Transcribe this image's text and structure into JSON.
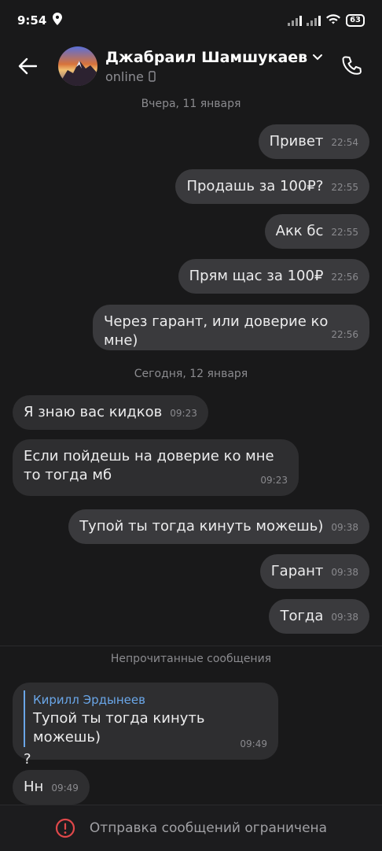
{
  "status_bar": {
    "time": "9:54",
    "battery": "63"
  },
  "header": {
    "name": "Джабраил Шамшукаев",
    "status": "online"
  },
  "dates": {
    "yesterday": "Вчера, 11 января",
    "today": "Сегодня, 12 января"
  },
  "messages": [
    {
      "text": "Привет",
      "time": "22:54",
      "dir": "out"
    },
    {
      "text": "Продашь за 100₽?",
      "time": "22:55",
      "dir": "out"
    },
    {
      "text": "Акк бс",
      "time": "22:55",
      "dir": "out"
    },
    {
      "text": "Прям щас за 100₽",
      "time": "22:56",
      "dir": "out"
    },
    {
      "text": "Через гарант, или доверие ко мне)",
      "time": "22:56",
      "dir": "out"
    },
    {
      "text": "Я знаю вас кидков",
      "time": "09:23",
      "dir": "in"
    },
    {
      "text": "Если пойдешь на доверие ко мне то тогда мб",
      "time": "09:23",
      "dir": "in"
    },
    {
      "text": "Тупой ты тогда кинуть можешь)",
      "time": "09:38",
      "dir": "out"
    },
    {
      "text": "Гарант",
      "time": "09:38",
      "dir": "out"
    },
    {
      "text": "Тогда",
      "time": "09:38",
      "dir": "out"
    },
    {
      "reply_author": "Кирилл Эрдынеев",
      "reply_text": "Тупой ты тогда кинуть можешь)",
      "text": "?",
      "time": "09:49",
      "dir": "in"
    },
    {
      "text": "Нн",
      "time": "09:49",
      "dir": "in"
    }
  ],
  "unread_label": "Непрочитанные сообщения",
  "footer": {
    "text": "Отправка сообщений ограничена"
  },
  "colors": {
    "bubble_in": "#2e2e30",
    "bubble_out": "#3a3a3d",
    "accent": "#6aa6e8",
    "warning": "#e0484a"
  }
}
